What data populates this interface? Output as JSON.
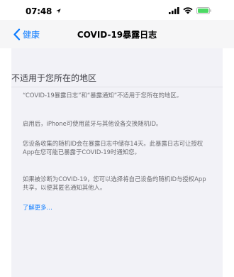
{
  "status_bar": {
    "time": "07:48"
  },
  "nav": {
    "back_label": "健康",
    "title": "COVID-19暴露日志"
  },
  "main": {
    "section_title": "不适用于您所在的地区",
    "paragraphs": [
      "“COVID-19暴露日志”和“暴露通知”不适用于您所在的地区。",
      "启用后，iPhone可使用蓝牙与其他设备交换随机ID。",
      "您设备收集的随机ID会在暴露日志中储存14天。此暴露日志可让授权App在您可能已暴露于COVID-19时通知您。",
      "如果被诊断为COVID-19，您可以选择将自己设备的随机ID与授权App共享，以便其匿名通知其他人。"
    ],
    "learn_more": "了解更多…"
  },
  "colors": {
    "accent": "#0a7aff",
    "battery": "#4cd964",
    "background_grouped": "#f2f2f7",
    "secondary_text": "#6d6d72"
  },
  "icons": {
    "location": "location-arrow-icon",
    "signal": "cellular-signal-icon",
    "wifi": "wifi-icon",
    "battery": "battery-icon",
    "back": "chevron-left-icon"
  }
}
